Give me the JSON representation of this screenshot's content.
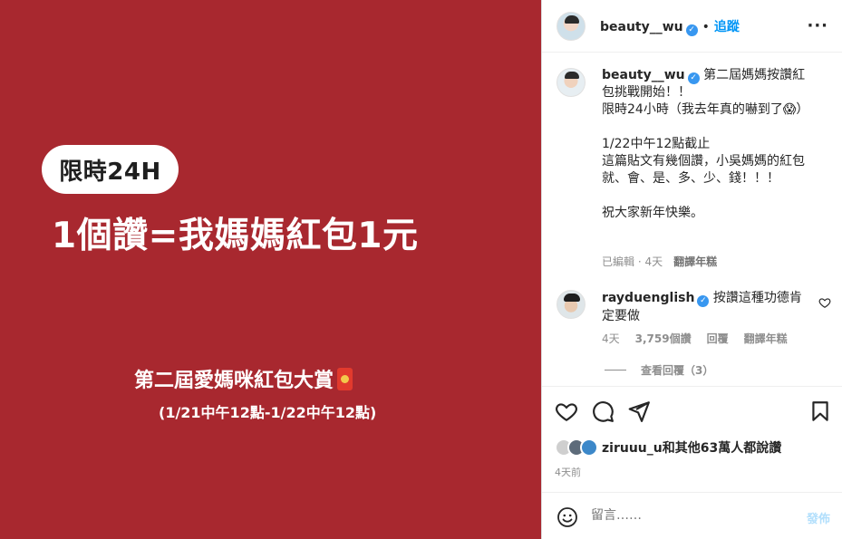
{
  "post_image": {
    "badge": "限時24H",
    "headline": "1個讚=我媽媽紅包1元",
    "event_title": "第二屆愛媽咪紅包大賞",
    "event_dates": "(1/21中午12點-1/22中午12點)"
  },
  "header": {
    "username": "beauty__wu",
    "verified_mark": "✓",
    "separator": "•",
    "follow_label": "追蹤",
    "more_label": "···"
  },
  "caption": {
    "username": "beauty__wu",
    "lines": [
      "第二屆媽媽按讚紅包挑戰開始！！",
      "限時24小時（我去年真的嚇到了😱）",
      "",
      "1/22中午12點截止",
      "這篇貼文有幾個讚，小吳媽媽的紅包",
      "就、會、是、多、少、錢！！！",
      "",
      "祝大家新年快樂。"
    ],
    "edited": "已編輯",
    "time": "4天",
    "translate": "翻譯年糕"
  },
  "comment": {
    "username": "rayduenglish",
    "text": "按讚這種功德肯定要做",
    "time": "4天",
    "likes": "3,759個讚",
    "reply": "回覆",
    "translate": "翻譯年糕",
    "view_replies": "查看回覆（3）"
  },
  "likes_summary": {
    "text": "ziruuu_u和其他63萬人都說讚",
    "posted": "4天前"
  },
  "comment_box": {
    "placeholder": "留言……",
    "post_label": "發佈"
  },
  "icons": [
    "heart-icon",
    "comment-icon",
    "share-icon",
    "bookmark-icon",
    "emoji-icon",
    "more-icon",
    "verified-icon"
  ],
  "colors": {
    "image_bg": "#a8282f",
    "follow": "#0095f6",
    "verified": "#3897f0",
    "muted": "#8e8e8e"
  }
}
